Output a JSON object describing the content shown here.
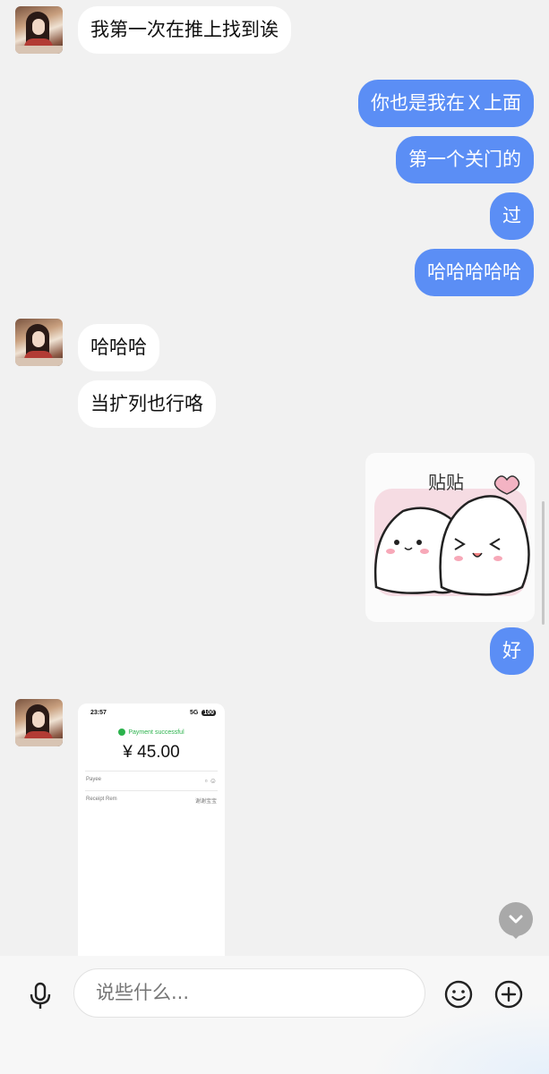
{
  "messages": {
    "m1": "我第一次在推上找到诶",
    "m2": "你也是我在Ｘ上面",
    "m3": "第一个关门的",
    "m4": "过",
    "m5": "哈哈哈哈哈",
    "m6": "哈哈哈",
    "m7": "当扩列也行咯",
    "m8": "好"
  },
  "sticker": {
    "text": "贴贴"
  },
  "receipt": {
    "time": "23:57",
    "network": "5G",
    "battery": "100",
    "status": "Payment successful",
    "amount": "¥ 45.00",
    "payee_label": "Payee",
    "remark_label": "Receipt Rem",
    "remark_value": "谢谢宝宝"
  },
  "input": {
    "placeholder": "说些什么..."
  },
  "icons": [
    "avatar",
    "sticker-image",
    "chevron-down-icon",
    "microphone-icon",
    "emoji-icon",
    "plus-icon"
  ],
  "colors": {
    "outgoing_bubble": "#5b8ef5",
    "incoming_bubble": "#ffffff",
    "background": "#f1f1f1",
    "success": "#2bb24c"
  }
}
